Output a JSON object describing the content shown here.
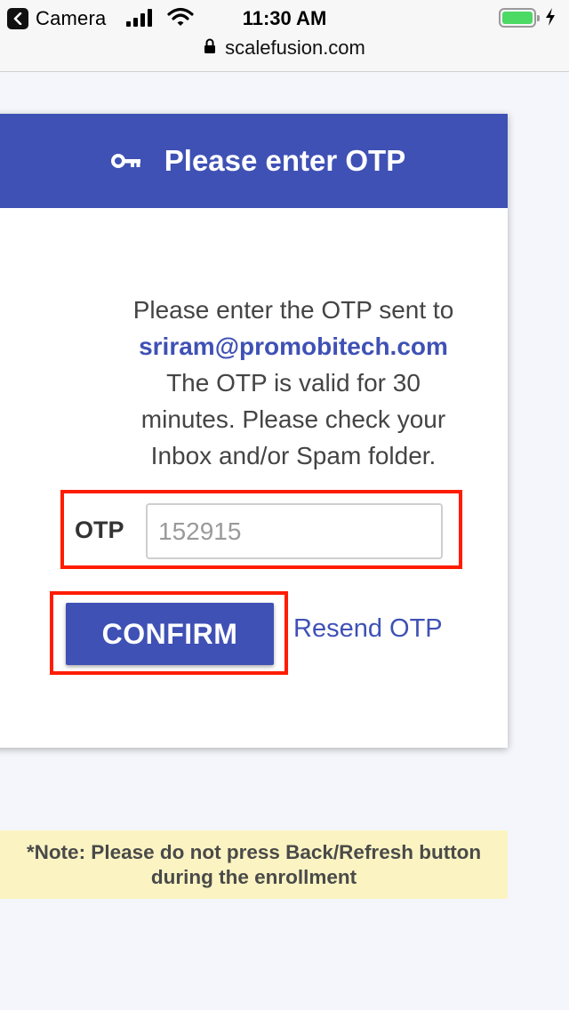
{
  "status_bar": {
    "back_app": "Camera",
    "time": "11:30 AM",
    "battery_color": "#4cd964"
  },
  "browser": {
    "url": "scalefusion.com"
  },
  "card": {
    "header_icon": "key-icon",
    "title": "Please enter OTP",
    "header_color": "#3f51b5",
    "message_line1": "Please enter the OTP sent to",
    "email": "sriram@promobitech.com",
    "message_line2": "The OTP is valid for 30",
    "message_line3": "minutes. Please check your",
    "message_line4": "Inbox and/or Spam folder.",
    "otp_label": "OTP",
    "otp_placeholder": "152915",
    "otp_value": "",
    "confirm_label": "CONFIRM",
    "resend_label": "Resend OTP"
  },
  "note": {
    "line1": "*Note: Please do not press Back/Refresh button",
    "line2": "during the enrollment",
    "background": "#fbf4c2"
  },
  "highlight_color": "#ff1c00"
}
